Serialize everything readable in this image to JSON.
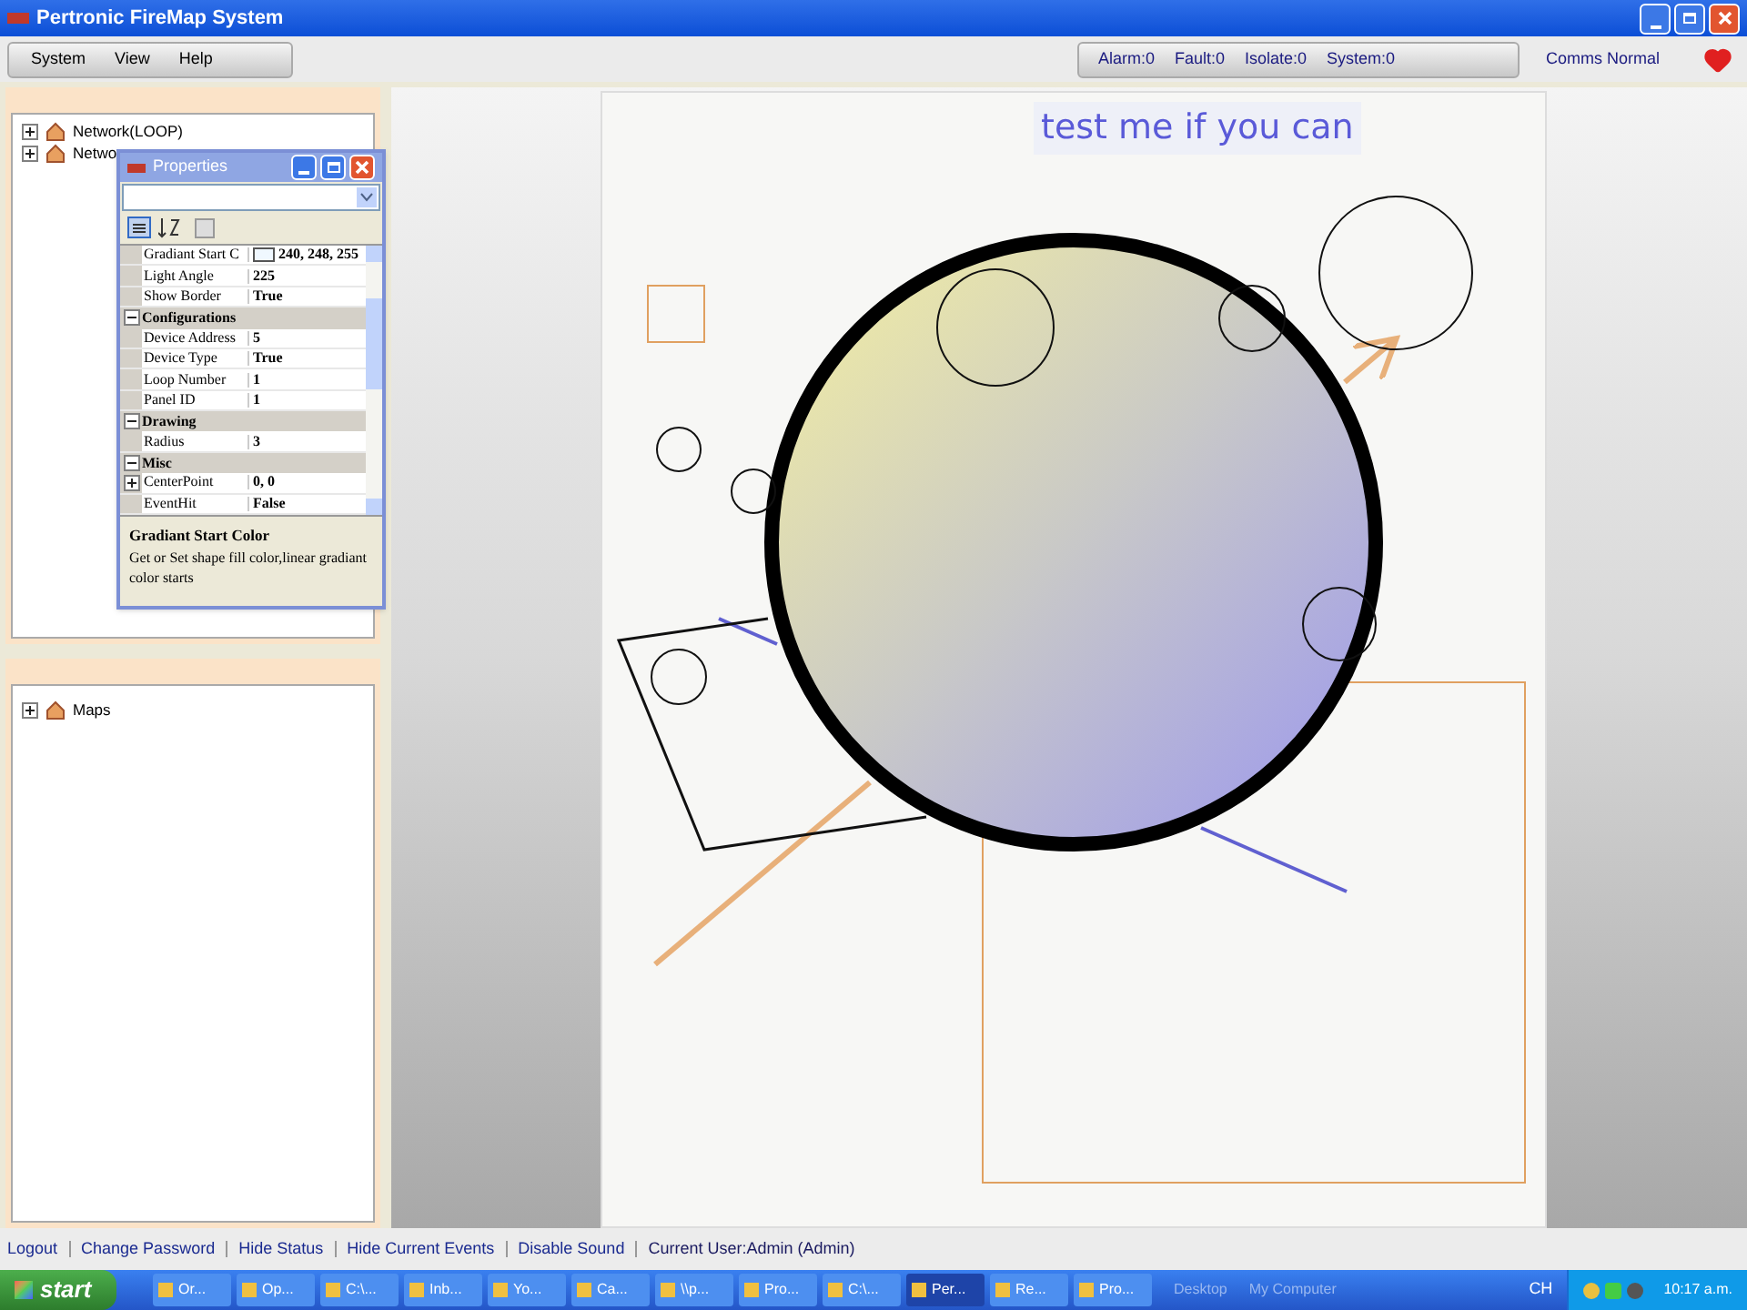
{
  "window": {
    "title": "Pertronic FireMap System"
  },
  "menu": [
    "System",
    "View",
    "Help"
  ],
  "status_counters": [
    "Alarm:0",
    "Fault:0",
    "Isolate:0",
    "System:0"
  ],
  "comms_status": "Comms Normal",
  "network_tree": [
    {
      "label": "Network(LOOP)",
      "expanded": false
    },
    {
      "label": "Netwo",
      "expanded": false
    }
  ],
  "properties": {
    "title": "Properties",
    "rows": [
      {
        "kind": "color",
        "name": "Gradiant Start C",
        "value": "240, 248, 255"
      },
      {
        "kind": "property",
        "name": "Light Angle",
        "value": "225"
      },
      {
        "kind": "property",
        "name": "Show Border",
        "value": "True"
      },
      {
        "kind": "category",
        "name": "Configurations",
        "expanded": true
      },
      {
        "kind": "property",
        "name": "Device Address",
        "value": "5"
      },
      {
        "kind": "property",
        "name": "Device Type",
        "value": "True"
      },
      {
        "kind": "property",
        "name": "Loop Number",
        "value": "1"
      },
      {
        "kind": "property",
        "name": "Panel ID",
        "value": "1"
      },
      {
        "kind": "category",
        "name": "Drawing",
        "expanded": true
      },
      {
        "kind": "property",
        "name": "Radius",
        "value": "3"
      },
      {
        "kind": "category",
        "name": "Misc",
        "expanded": true
      },
      {
        "kind": "property",
        "name": "CenterPoint",
        "value": "0, 0",
        "expanded": false
      },
      {
        "kind": "property",
        "name": "EventHit",
        "value": "False"
      }
    ],
    "description": {
      "title": "Gradiant Start Color",
      "text": "Get or Set shape fill color,linear gradiant color starts"
    }
  },
  "maps_tree": [
    {
      "label": "Maps",
      "expanded": false
    }
  ],
  "canvas": {
    "caption": "test me if you can"
  },
  "footer": {
    "links": [
      "Logout",
      "Change Password",
      "Hide Status",
      "Hide Current Events",
      "Disable Sound"
    ],
    "current_user": "Current User:Admin (Admin)"
  },
  "taskbar": {
    "start": "start",
    "tasks": [
      {
        "label": "Or...",
        "selected": false
      },
      {
        "label": "Op...",
        "selected": false
      },
      {
        "label": "C:\\...",
        "selected": false
      },
      {
        "label": "Inb...",
        "selected": false
      },
      {
        "label": "Yo...",
        "selected": false
      },
      {
        "label": "Ca...",
        "selected": false
      },
      {
        "label": "\\\\p...",
        "selected": false
      },
      {
        "label": "Pro...",
        "selected": false
      },
      {
        "label": "C:\\...",
        "selected": false
      },
      {
        "label": "Per...",
        "selected": true
      },
      {
        "label": "Re...",
        "selected": false
      },
      {
        "label": "Pro...",
        "selected": false
      }
    ],
    "toolbars": [
      "Desktop",
      "My Computer"
    ],
    "language": "CH",
    "clock": "10:17 a.m."
  }
}
